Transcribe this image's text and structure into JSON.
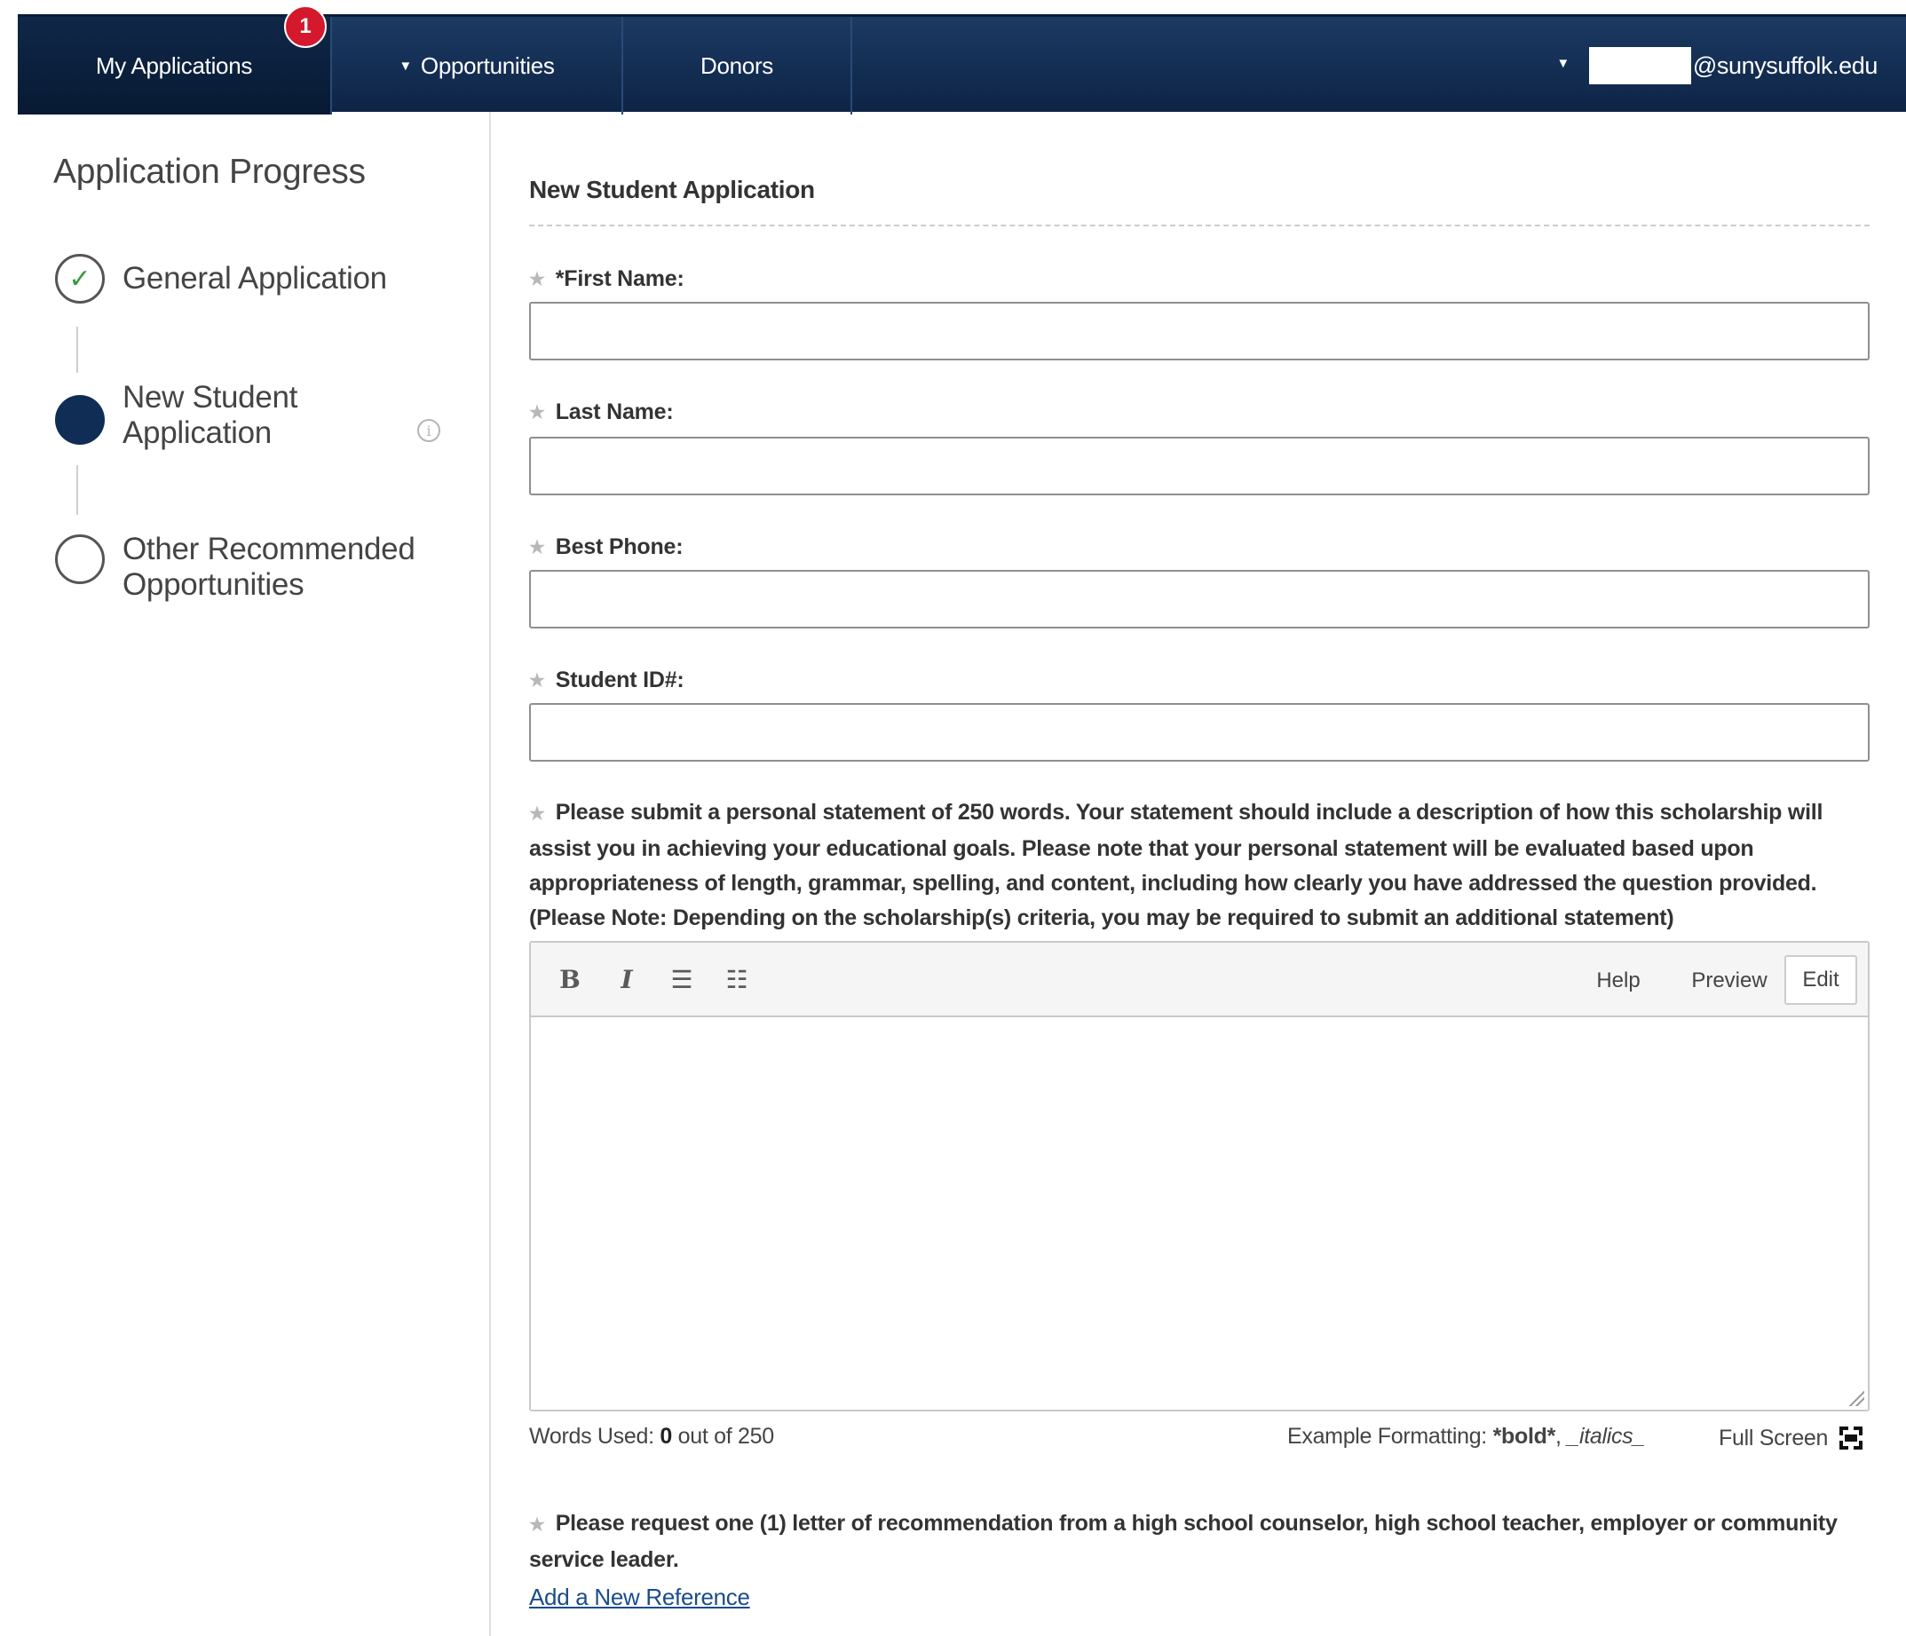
{
  "nav": {
    "tabs": [
      {
        "label": "My Applications",
        "badge": "1"
      },
      {
        "label": "Opportunities"
      },
      {
        "label": "Donors"
      }
    ],
    "user_email": "@sunysuffolk.edu"
  },
  "sidebar": {
    "title": "Application Progress",
    "steps": [
      {
        "label_line1": "General Application",
        "status": "complete"
      },
      {
        "label_line1": "New Student",
        "label_line2": "Application",
        "status": "current"
      },
      {
        "label_line1": "Other Recommended",
        "label_line2": "Opportunities",
        "status": "incomplete"
      }
    ],
    "info_glyph": "i"
  },
  "form": {
    "heading": "New Student Application",
    "fields": [
      {
        "label": "*First Name:",
        "value": ""
      },
      {
        "label": "Last Name:",
        "value": ""
      },
      {
        "label": "Best Phone:",
        "value": ""
      },
      {
        "label": "Student ID#:",
        "value": ""
      }
    ],
    "statement_prompt": "Please submit a personal statement of 250 words. Your statement should include a description of how this scholarship will assist you in achieving your educational goals. Please note that your personal statement will be evaluated based upon appropriateness of length, grammar, spelling, and content, including how clearly you have addressed the question provided. (Please Note: Depending on the scholarship(s) criteria, you may be required to submit an additional statement)",
    "editor": {
      "bold_glyph": "B",
      "italic_glyph": "I",
      "ol_glyph": "☰",
      "ul_glyph": "☷",
      "help_label": "Help",
      "preview_label": "Preview",
      "edit_label": "Edit",
      "value": ""
    },
    "words_used_label": "Words Used:",
    "words_used_count": "0",
    "words_used_suffix": "out of 250",
    "example_formatting_label": "Example Formatting:",
    "example_bold": "*bold*",
    "example_sep": ",",
    "example_italics": "_italics_",
    "fullscreen_label": "Full Screen",
    "reference_prompt": "Please request one (1) letter of recommendation from a high school counselor, high school teacher, employer or community service leader.",
    "add_reference_label": "Add a New Reference"
  },
  "colors": {
    "nav_bg": "#0d2446",
    "badge": "#d4192c",
    "current_step": "#0f2d55",
    "check": "#3a9a3a",
    "link": "#1a4c8c"
  }
}
